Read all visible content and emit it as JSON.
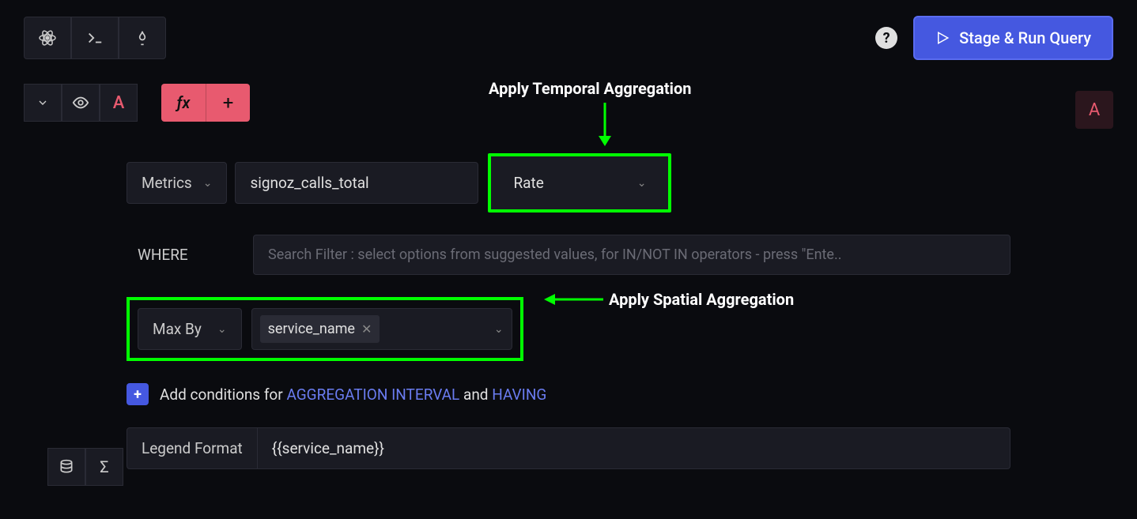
{
  "topbar": {
    "run_button": "Stage & Run Query"
  },
  "query": {
    "letter": "A",
    "metrics_label": "Metrics",
    "metric_value": "signoz_calls_total",
    "temporal_agg": "Rate",
    "where_label": "WHERE",
    "where_placeholder": "Search Filter : select options from suggested values, for IN/NOT IN operators - press \"Ente..",
    "spatial_agg": "Max By",
    "groupby_tag": "service_name",
    "conditions_prefix": "Add conditions for ",
    "conditions_link1": "AGGREGATION INTERVAL",
    "conditions_mid": " and ",
    "conditions_link2": "HAVING",
    "legend_label": "Legend Format",
    "legend_value": "{{service_name}}"
  },
  "annotations": {
    "temporal": "Apply Temporal Aggregation",
    "spatial": "Apply Spatial Aggregation"
  }
}
